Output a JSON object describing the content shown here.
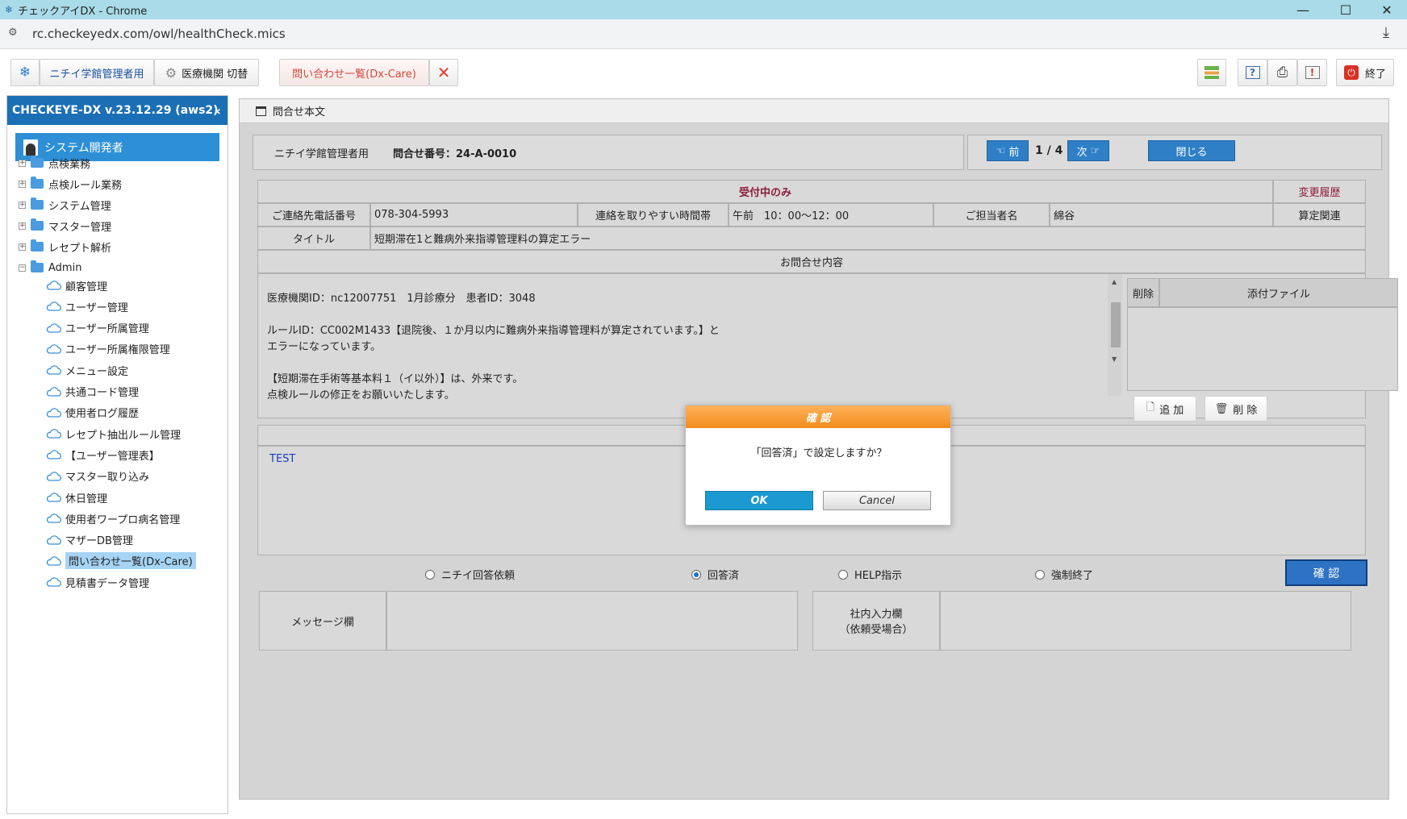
{
  "window": {
    "title": "チェックアイDX - Chrome",
    "url": "rc.checkeyedx.com/owl/healthCheck.mics"
  },
  "toolbar": {
    "org_label": "ニチイ学館管理者用",
    "switch_label": "医療機関 切替",
    "tab_label": "問い合わせ一覧(Dx-Care)",
    "exit_label": "終了"
  },
  "sidebar": {
    "header": "CHECKEYE-DX v.23.12.29 (aws2)",
    "user": "システム開発者",
    "folders": [
      {
        "label": "点検業務",
        "expander": "+"
      },
      {
        "label": "点検ルール業務",
        "expander": "+"
      },
      {
        "label": "システム管理",
        "expander": "+"
      },
      {
        "label": "マスター管理",
        "expander": "+"
      },
      {
        "label": "レセプト解析",
        "expander": "+"
      },
      {
        "label": "Admin",
        "expander": "−"
      }
    ],
    "admin_items": [
      "顧客管理",
      "ユーザー管理",
      "ユーザー所属管理",
      "ユーザー所属権限管理",
      "メニュー設定",
      "共通コード管理",
      "使用者ログ履歴",
      "レセプト抽出ルール管理",
      "【ユーザー管理表】",
      "マスター取り込み",
      "休日管理",
      "使用者ワープロ病名管理",
      "マザーDB管理",
      "問い合わせ一覧(Dx-Care)",
      "見積書データ管理"
    ],
    "active_item": "問い合わせ一覧(Dx-Care)"
  },
  "panel": {
    "title": "問合せ本文",
    "org": "ニチイ学館管理者用",
    "inquiry_no": "問合せ番号：24-A-0010",
    "prev_label": "前",
    "page_indicator": "1 / 4",
    "next_label": "次",
    "close_label": "閉じる",
    "status": "受付中のみ",
    "history_link": "変更履歴",
    "phone_label": "ご連絡先電話番号",
    "phone_value": "078-304-5993",
    "time_label": "連絡を取りやすい時間帯",
    "time_value": "午前　10：00〜12：00",
    "person_label": "ご担当者名",
    "person_value": "綿谷",
    "calc_label": "算定関連",
    "title_label": "タイトル",
    "title_value": "短期滞在1と難病外来指導管理料の算定エラー",
    "content_header": "お問合せ内容",
    "content_lines": [
      "医療機関ID：nc12007751　1月診療分　患者ID：3048",
      "",
      "ルールID：CC002M1433【退院後、１か月以内に難病外来指導管理料が算定されています。】と",
      "エラーになっています。",
      "",
      "【短期滞在手術等基本料１（イ以外）】は、外来です。",
      "点検ルールの修正をお願いいたします。"
    ],
    "attach_delete": "削除",
    "attach_header": "添付ファイル",
    "add_label": "追 加",
    "del_label": "削 除",
    "reply_text": "TEST",
    "radios": [
      {
        "label": "ニチイ回答依頼",
        "checked": false
      },
      {
        "label": "回答済",
        "checked": true
      },
      {
        "label": "HELP指示",
        "checked": false
      },
      {
        "label": "強制終了",
        "checked": false
      }
    ],
    "confirm_label": "確 認",
    "message_label": "メッセージ欄",
    "internal_label_1": "社内入力欄",
    "internal_label_2": "（依頼受場合）"
  },
  "modal": {
    "title": "確 認",
    "message": "「回答済」で設定しますか？",
    "ok_label": "OK",
    "cancel_label": "Cancel"
  },
  "colors": {
    "accent": "#2e7fc6",
    "modal_header": "#f28b1c",
    "sidebar_header": "#1a6fb5",
    "status_text": "#8b1c3a"
  }
}
